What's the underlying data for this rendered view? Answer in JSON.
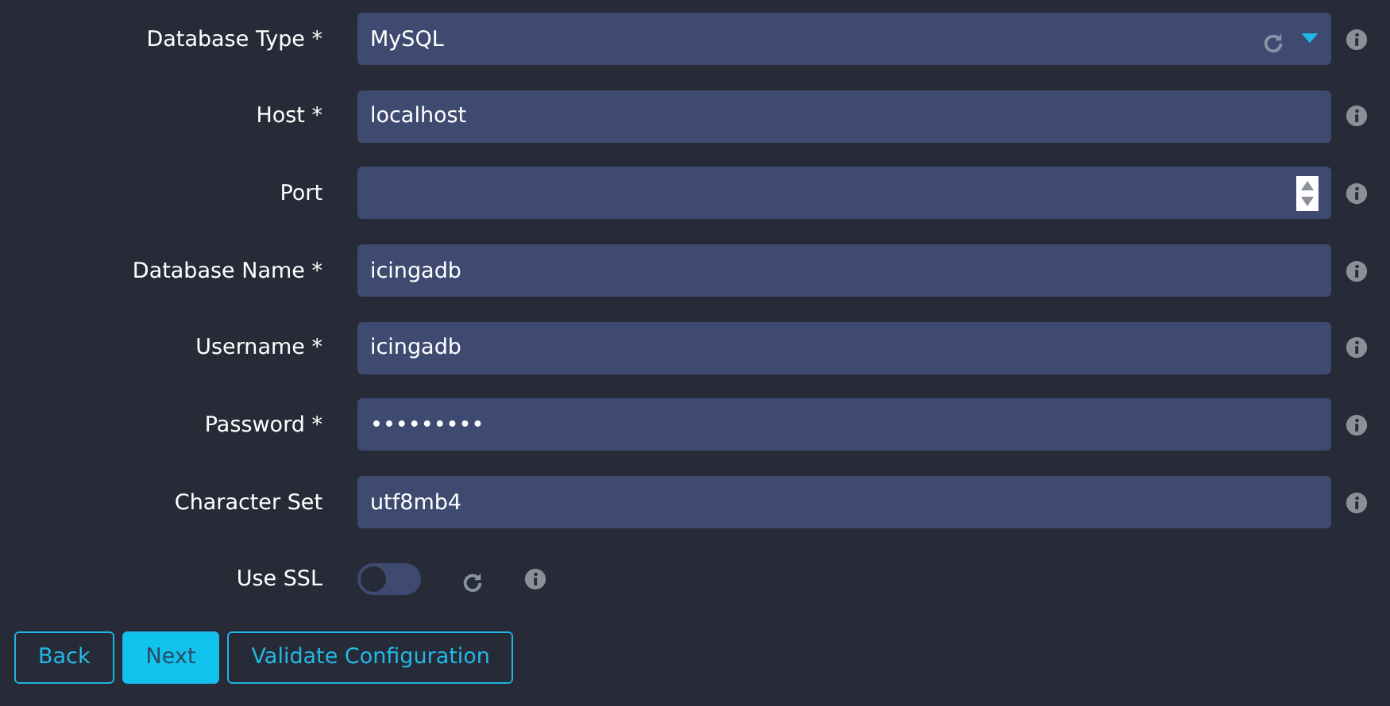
{
  "fields": [
    {
      "kind": "select",
      "label": "Database Type *",
      "value": "MySQL"
    },
    {
      "kind": "text",
      "label": "Host *",
      "value": "localhost"
    },
    {
      "kind": "number",
      "label": "Port"
    },
    {
      "kind": "text",
      "label": "Database Name *",
      "value": "icingadb"
    },
    {
      "kind": "text",
      "label": "Username *",
      "value": "icingadb"
    },
    {
      "kind": "text",
      "label": "Password *",
      "value": "•••••••••"
    },
    {
      "kind": "text",
      "label": "Character Set",
      "value": "utf8mb4"
    },
    {
      "kind": "toggle",
      "label": "Use SSL",
      "on": false
    }
  ],
  "buttons": [
    {
      "label": "Back",
      "kind": "outline"
    },
    {
      "label": "Next",
      "kind": "primary"
    },
    {
      "label": "Validate Configuration",
      "kind": "outline"
    }
  ]
}
